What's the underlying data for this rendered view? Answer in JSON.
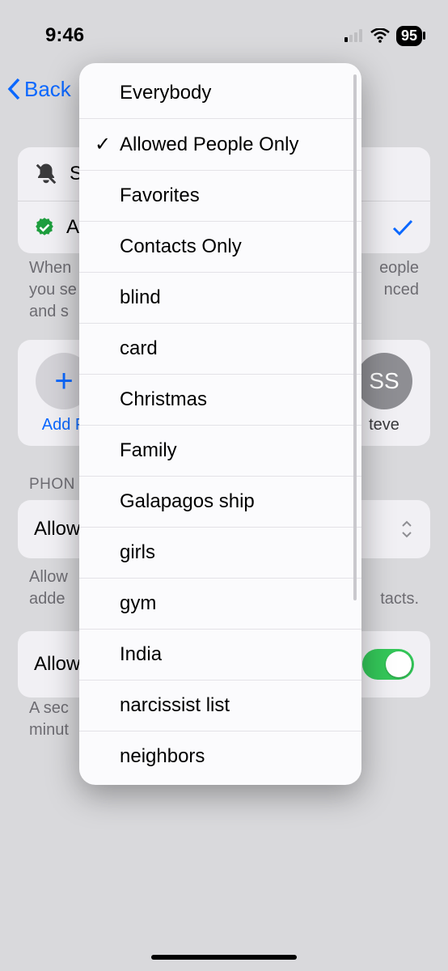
{
  "status": {
    "time": "9:46",
    "battery": "95"
  },
  "nav": {
    "back": "Back"
  },
  "card1": {
    "row1": "S",
    "row2": "A"
  },
  "help1": {
    "a": "When",
    "b": "eople",
    "c": "you se",
    "d": "nced",
    "e": "and s"
  },
  "avatars": {
    "add_label": "Add P",
    "ss_initials": "SS",
    "ss_label": "teve"
  },
  "section_phone": "PHON",
  "allow_row": "Allow",
  "help2": {
    "a": "Allow",
    "b": "adde",
    "c": "tacts."
  },
  "repeat_row": "Allow",
  "help3": {
    "a": "A sec",
    "b": "minut"
  },
  "popover": {
    "items": [
      {
        "label": "Everybody",
        "checked": false
      },
      {
        "label": "Allowed People Only",
        "checked": true
      },
      {
        "label": "Favorites",
        "checked": false
      },
      {
        "label": "Contacts Only",
        "checked": false
      },
      {
        "label": "blind",
        "checked": false
      },
      {
        "label": "card",
        "checked": false
      },
      {
        "label": "Christmas",
        "checked": false
      },
      {
        "label": "Family",
        "checked": false
      },
      {
        "label": "Galapagos ship",
        "checked": false
      },
      {
        "label": "girls",
        "checked": false
      },
      {
        "label": "gym",
        "checked": false
      },
      {
        "label": "India",
        "checked": false
      },
      {
        "label": "narcissist list",
        "checked": false
      },
      {
        "label": "neighbors",
        "checked": false
      }
    ]
  }
}
